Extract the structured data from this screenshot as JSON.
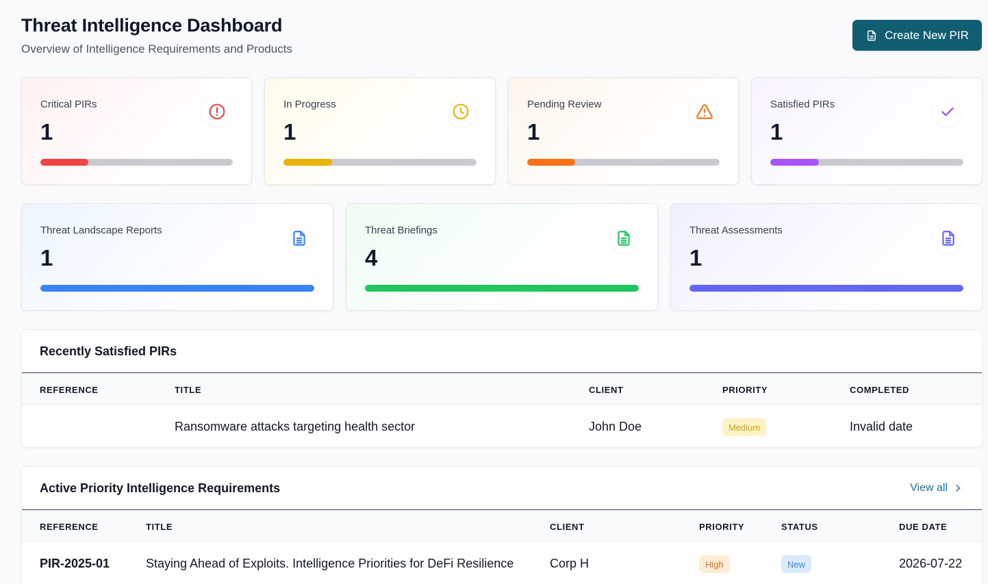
{
  "header": {
    "title": "Threat Intelligence Dashboard",
    "subtitle": "Overview of Intelligence Requirements and Products",
    "create_button": "Create New PIR"
  },
  "pir_stats": [
    {
      "label": "Critical PIRs",
      "value": "1",
      "icon": "alert-circle-icon",
      "color": "#ef4444",
      "progress": 0.25
    },
    {
      "label": "In Progress",
      "value": "1",
      "icon": "clock-icon",
      "color": "#eab308",
      "progress": 0.25
    },
    {
      "label": "Pending Review",
      "value": "1",
      "icon": "warning-triangle-icon",
      "color": "#f97316",
      "progress": 0.25
    },
    {
      "label": "Satisfied PIRs",
      "value": "1",
      "icon": "check-icon",
      "color": "#a855f7",
      "progress": 0.25
    }
  ],
  "product_stats": [
    {
      "label": "Threat Landscape Reports",
      "value": "1",
      "icon": "document-icon",
      "color": "#3b82f6",
      "progress": 1
    },
    {
      "label": "Threat Briefings",
      "value": "4",
      "icon": "document-icon",
      "color": "#22c55e",
      "progress": 1
    },
    {
      "label": "Threat Assessments",
      "value": "1",
      "icon": "document-icon",
      "color": "#6366f1",
      "progress": 1
    }
  ],
  "recently_satisfied": {
    "title": "Recently Satisfied PIRs",
    "columns": [
      "Reference",
      "Title",
      "Client",
      "Priority",
      "Completed"
    ],
    "rows": [
      {
        "reference": "",
        "title": "Ransomware attacks targeting health sector",
        "client": "John Doe",
        "priority": "Medium",
        "completed": "Invalid date"
      }
    ]
  },
  "active_pirs": {
    "title": "Active Priority Intelligence Requirements",
    "view_all": "View all",
    "columns": [
      "Reference",
      "Title",
      "Client",
      "Priority",
      "Status",
      "Due Date"
    ],
    "rows": [
      {
        "reference": "PIR-2025-01",
        "title": "Staying Ahead of Exploits. Intelligence Priorities for DeFi Resilience",
        "client": "Corp H",
        "priority": "High",
        "status": "New",
        "due_date": "2026-07-22"
      }
    ]
  }
}
